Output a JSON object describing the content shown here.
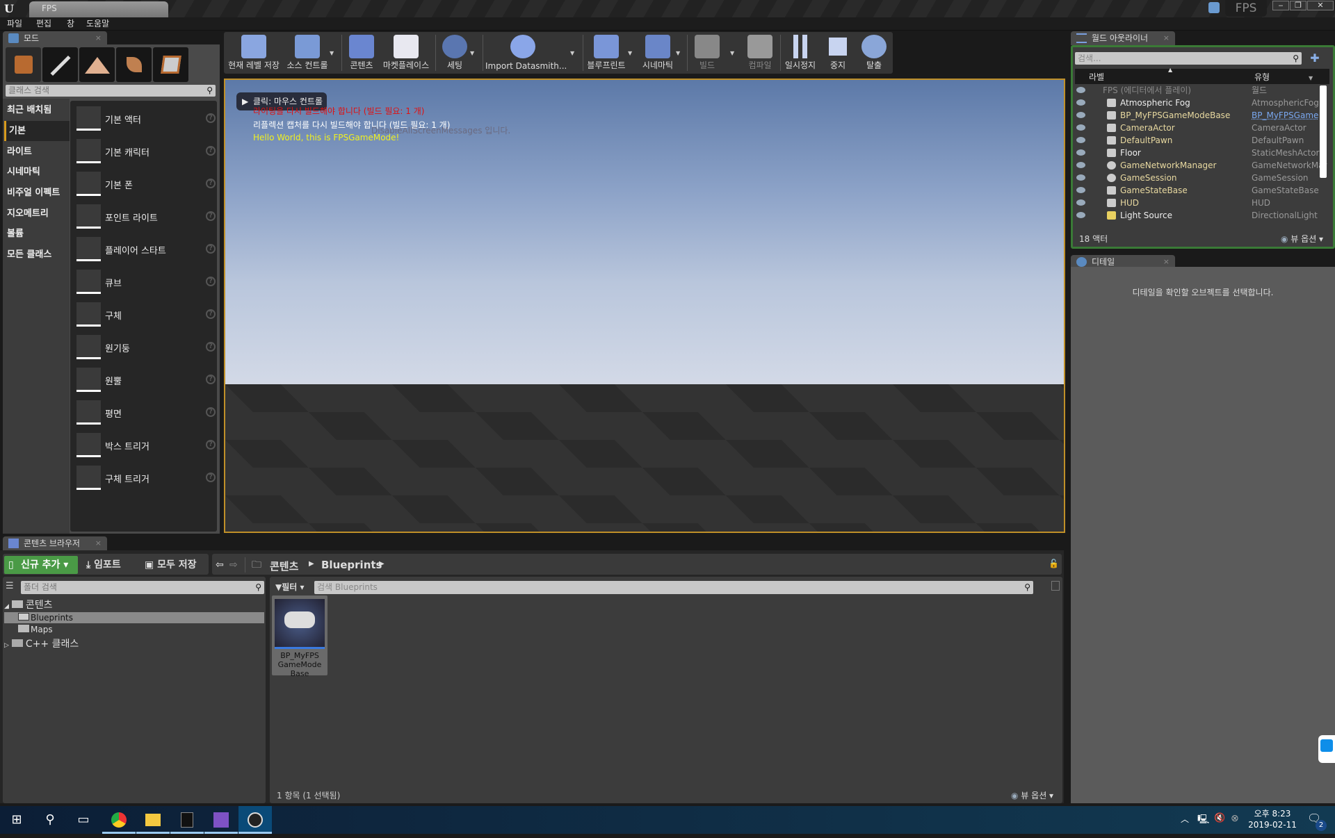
{
  "window": {
    "doc_tab": "FPS",
    "project_name": "FPS",
    "controls": {
      "minimize": "‒",
      "restore": "❐",
      "close": "✕"
    }
  },
  "menu": [
    "파일",
    "편집",
    "창",
    "도움말"
  ],
  "modes_panel": {
    "tab_label": "모드",
    "mode_icons": [
      "place-mode-icon",
      "paint-mode-icon",
      "landscape-mode-icon",
      "foliage-mode-icon",
      "geometry-mode-icon"
    ],
    "search_placeholder": "클래스 검색",
    "categories": [
      {
        "label": "최근 배치됨",
        "selected": false
      },
      {
        "label": "기본",
        "selected": true
      },
      {
        "label": "라이트",
        "selected": false
      },
      {
        "label": "시네마틱",
        "selected": false
      },
      {
        "label": "비주얼 이펙트",
        "selected": false
      },
      {
        "label": "지오메트리",
        "selected": false
      },
      {
        "label": "볼륨",
        "selected": false
      },
      {
        "label": "모든 클래스",
        "selected": false
      }
    ],
    "items": [
      "기본 액터",
      "기본 캐릭터",
      "기본 폰",
      "포인트 라이트",
      "플레이어 스타트",
      "큐브",
      "구체",
      "원기둥",
      "원뿔",
      "평면",
      "박스 트리거",
      "구체 트리거"
    ],
    "help_glyph": "?"
  },
  "toolbar": {
    "buttons": [
      {
        "label": "현재 레벨 저장",
        "icon": "save-icon",
        "enabled": true
      },
      {
        "label": "소스 컨트롤",
        "icon": "source-control-icon",
        "enabled": true
      },
      {
        "label": "콘텐츠",
        "icon": "content-icon",
        "enabled": true
      },
      {
        "label": "마켓플레이스",
        "icon": "marketplace-icon",
        "enabled": true
      },
      {
        "label": "세팅",
        "icon": "settings-icon",
        "enabled": true
      },
      {
        "label": "Import Datasmith...",
        "icon": "datasmith-icon",
        "enabled": true
      },
      {
        "label": "블루프린트",
        "icon": "blueprint-icon",
        "enabled": true
      },
      {
        "label": "시네마틱",
        "icon": "cinematics-icon",
        "enabled": true
      },
      {
        "label": "빌드",
        "icon": "build-icon",
        "enabled": false
      },
      {
        "label": "컴파일",
        "icon": "compile-icon",
        "enabled": false
      },
      {
        "label": "일시정지",
        "icon": "pause-icon",
        "enabled": true
      },
      {
        "label": "중지",
        "icon": "stop-icon",
        "enabled": true
      },
      {
        "label": "탈출",
        "icon": "eject-icon",
        "enabled": true
      }
    ]
  },
  "viewport": {
    "click_hint": "클릭: 마우스 컨트롤",
    "messages": [
      {
        "text": "라이팅을 다시 빌드해야 합니다 (빌드 필요: 1 개)",
        "color": "#e01010"
      },
      {
        "text": "리플렉션 캡처를 다시 빌드해야 합니다 (빌드 필요: 1 개)",
        "color": "#ffffff"
      },
      {
        "text": "Hello World, this is FPSGameMode!",
        "color": "#f0f020"
      }
    ],
    "background_message": "DisableAllScreenMessages 입니다."
  },
  "world_outliner": {
    "tab_label": "월드 아웃라이너",
    "search_placeholder": "검색...",
    "col_label": "라벨",
    "col_type": "유형",
    "rows": [
      {
        "name": "FPS (에디터에서 플레이)",
        "type": "월드"
      },
      {
        "name": "Atmospheric Fog",
        "type": "AtmosphericFog"
      },
      {
        "name": "BP_MyFPSGameModeBase",
        "type": "BP_MyFPSGame"
      },
      {
        "name": "CameraActor",
        "type": "CameraActor"
      },
      {
        "name": "DefaultPawn",
        "type": "DefaultPawn"
      },
      {
        "name": "Floor",
        "type": "StaticMeshActor"
      },
      {
        "name": "GameNetworkManager",
        "type": "GameNetworkMar"
      },
      {
        "name": "GameSession",
        "type": "GameSession"
      },
      {
        "name": "GameStateBase",
        "type": "GameStateBase"
      },
      {
        "name": "HUD",
        "type": "HUD"
      },
      {
        "name": "Light Source",
        "type": "DirectionalLight"
      }
    ],
    "actor_count": "18 액터",
    "view_options": "뷰 옵션"
  },
  "details": {
    "tab_label": "디테일",
    "empty_message": "디테일을 확인할 오브젝트를 선택합니다."
  },
  "content_browser": {
    "tab_label": "콘텐츠 브라우저",
    "add_new": "신규 추가",
    "import": "임포트",
    "save_all": "모두 저장",
    "breadcrumb": [
      "콘텐츠",
      "Blueprints"
    ],
    "folder_search_placeholder": "폴더 검색",
    "filter_label": "필터",
    "asset_search_placeholder": "검색 Blueprints",
    "tree": [
      {
        "label": "콘텐츠",
        "level": 0,
        "expanded": true
      },
      {
        "label": "Blueprints",
        "level": 1,
        "selected": true
      },
      {
        "label": "Maps",
        "level": 1
      },
      {
        "label": "C++ 클래스",
        "level": 0,
        "expanded": false
      }
    ],
    "assets": [
      {
        "name": "BP_MyFPS GameMode Base"
      }
    ],
    "status": "1 항목 (1 선택됨)",
    "view_options": "뷰 옵션"
  },
  "taskbar": {
    "apps": [
      "start-icon",
      "search-icon",
      "task-view-icon",
      "chrome-icon",
      "file-explorer-icon",
      "epic-games-icon",
      "visual-studio-icon",
      "unreal-engine-icon"
    ],
    "time": "오후 8:23",
    "date": "2019-02-11",
    "notification_count": "2"
  }
}
